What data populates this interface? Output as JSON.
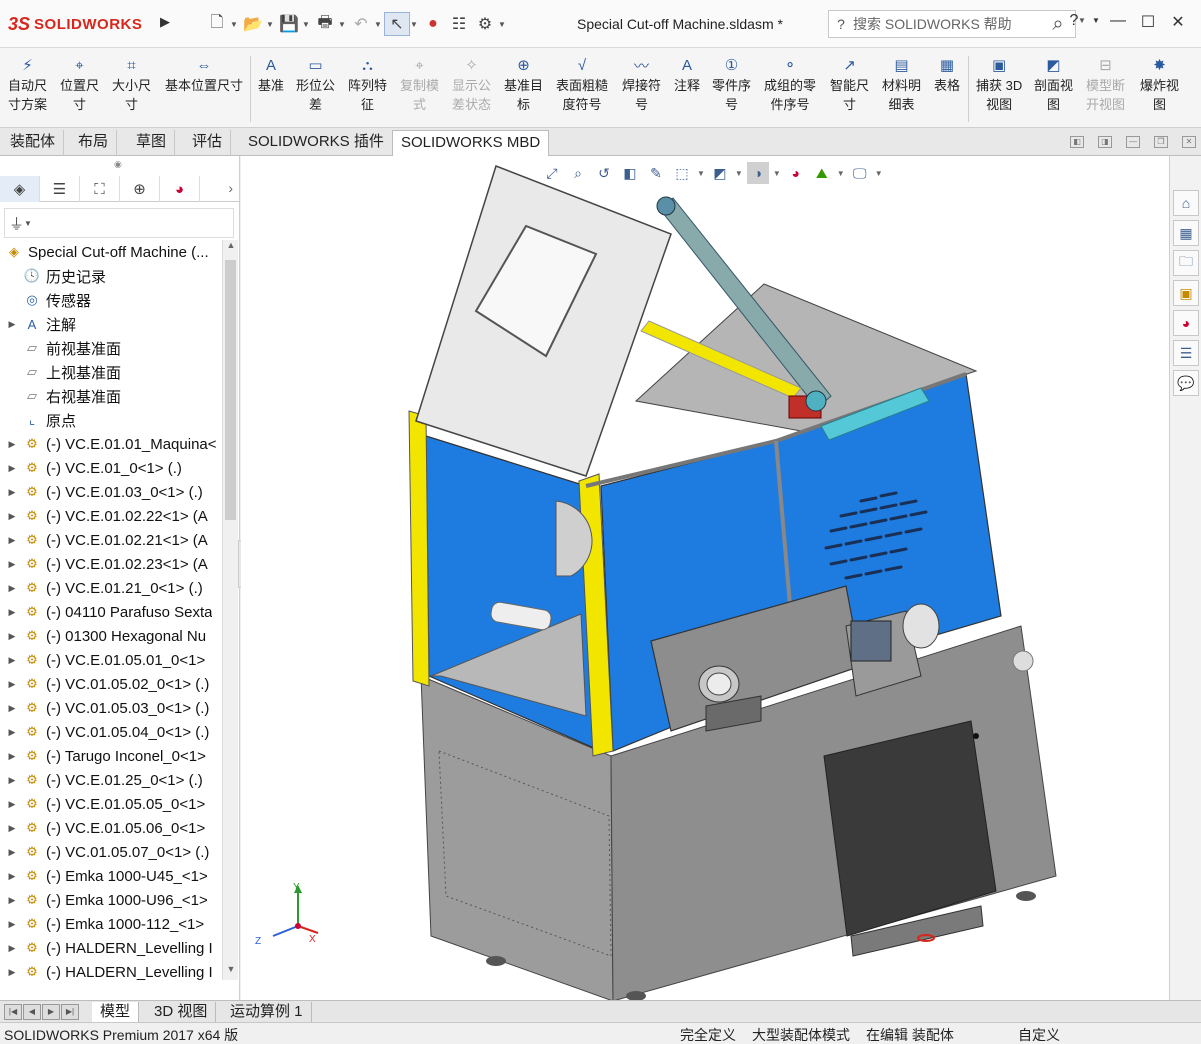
{
  "title_bar": {
    "brand_ds": "3S",
    "brand_name": "SOLIDWORKS",
    "document_title": "Special Cut-off Machine.sldasm *",
    "search_placeholder": "搜索 SOLIDWORKS 帮助",
    "help": "?"
  },
  "ribbon": {
    "buttons": [
      {
        "label": "自动尺\n寸方案",
        "icon": "auto-dimension-icon"
      },
      {
        "label": "位置尺\n寸",
        "icon": "location-dimension-icon"
      },
      {
        "label": "大小尺\n寸",
        "icon": "size-dimension-icon"
      },
      {
        "label": "基本位置尺寸",
        "icon": "basic-location-dimension-icon"
      },
      {
        "label": "基准",
        "icon": "datum-icon"
      },
      {
        "label": "形位公\n差",
        "icon": "geometric-tolerance-icon"
      },
      {
        "label": "阵列特\n征",
        "icon": "pattern-feature-icon"
      },
      {
        "label": "复制模\n式",
        "icon": "copy-scheme-icon",
        "disabled": true
      },
      {
        "label": "显示公\n差状态",
        "icon": "show-tolerance-status-icon",
        "disabled": true
      },
      {
        "label": "基准目\n标",
        "icon": "datum-target-icon"
      },
      {
        "label": "表面粗糙\n度符号",
        "icon": "surface-finish-icon"
      },
      {
        "label": "焊接符\n号",
        "icon": "weld-symbol-icon"
      },
      {
        "label": "注释",
        "icon": "note-icon"
      },
      {
        "label": "零件序\n号",
        "icon": "balloon-icon"
      },
      {
        "label": "成组的零\n件序号",
        "icon": "stacked-balloon-icon"
      },
      {
        "label": "智能尺\n寸",
        "icon": "smart-dimension-icon"
      },
      {
        "label": "材料明\n细表",
        "icon": "bom-icon"
      },
      {
        "label": "表格",
        "icon": "table-icon"
      },
      {
        "label": "捕获 3D\n视图",
        "icon": "capture-3d-view-icon"
      },
      {
        "label": "剖面视\n图",
        "icon": "section-view-icon"
      },
      {
        "label": "模型断\n开视图",
        "icon": "model-break-view-icon",
        "disabled": true
      },
      {
        "label": "爆炸视\n图",
        "icon": "exploded-view-icon"
      }
    ]
  },
  "tabs": [
    "装配体",
    "布局",
    "草图",
    "评估",
    "SOLIDWORKS 插件",
    "SOLIDWORKS MBD"
  ],
  "active_tab": "SOLIDWORKS MBD",
  "feature_tree": {
    "root": "Special Cut-off Machine  (...",
    "items": [
      {
        "label": "历史记录",
        "icon": "history-icon",
        "expand": false
      },
      {
        "label": "传感器",
        "icon": "sensor-icon",
        "expand": false
      },
      {
        "label": "注解",
        "icon": "annotations-icon",
        "expand": true
      },
      {
        "label": "前视基准面",
        "icon": "plane-icon",
        "expand": false
      },
      {
        "label": "上视基准面",
        "icon": "plane-icon",
        "expand": false
      },
      {
        "label": "右视基准面",
        "icon": "plane-icon",
        "expand": false
      },
      {
        "label": "原点",
        "icon": "origin-icon",
        "expand": false
      },
      {
        "label": "(-) VC.E.01.01_Maquina<",
        "icon": "component-icon",
        "expand": true
      },
      {
        "label": "(-) VC.E.01_0<1> (.)",
        "icon": "component-icon",
        "expand": true
      },
      {
        "label": "(-) VC.E.01.03_0<1> (.)",
        "icon": "component-icon",
        "expand": true
      },
      {
        "label": "(-) VC.E.01.02.22<1> (A",
        "icon": "component-icon",
        "expand": true
      },
      {
        "label": "(-) VC.E.01.02.21<1> (A",
        "icon": "component-icon",
        "expand": true
      },
      {
        "label": "(-) VC.E.01.02.23<1> (A",
        "icon": "component-icon",
        "expand": true
      },
      {
        "label": "(-) VC.E.01.21_0<1> (.)",
        "icon": "component-icon",
        "expand": true
      },
      {
        "label": "(-) 04110 Parafuso Sexta",
        "icon": "component-icon",
        "expand": true
      },
      {
        "label": "(-) 01300 Hexagonal Nu",
        "icon": "component-icon",
        "expand": true
      },
      {
        "label": "(-) VC.E.01.05.01_0<1>",
        "icon": "component-icon",
        "expand": true
      },
      {
        "label": "(-) VC.01.05.02_0<1> (.)",
        "icon": "component-icon",
        "expand": true
      },
      {
        "label": "(-) VC.01.05.03_0<1> (.)",
        "icon": "component-icon",
        "expand": true
      },
      {
        "label": "(-) VC.01.05.04_0<1> (.)",
        "icon": "component-icon",
        "expand": true
      },
      {
        "label": "(-) Tarugo Inconel_0<1>",
        "icon": "component-icon",
        "expand": true
      },
      {
        "label": "(-) VC.E.01.25_0<1> (.)",
        "icon": "component-icon",
        "expand": true
      },
      {
        "label": "(-) VC.E.01.05.05_0<1>",
        "icon": "component-icon",
        "expand": true
      },
      {
        "label": "(-) VC.E.01.05.06_0<1>",
        "icon": "component-icon",
        "expand": true
      },
      {
        "label": "(-) VC.01.05.07_0<1> (.)",
        "icon": "component-icon",
        "expand": true
      },
      {
        "label": "(-) Emka 1000-U45_<1>",
        "icon": "component-icon",
        "expand": true
      },
      {
        "label": "(-) Emka 1000-U96_<1>",
        "icon": "component-icon",
        "expand": true
      },
      {
        "label": "(-) Emka 1000-112_<1>",
        "icon": "component-icon",
        "expand": true
      },
      {
        "label": "(-) HALDERN_Levelling I",
        "icon": "component-icon",
        "expand": true
      },
      {
        "label": "(-) HALDERN_Levelling I",
        "icon": "component-icon",
        "expand": true
      }
    ]
  },
  "triad": {
    "y": "Y",
    "z": "Z",
    "x": "X"
  },
  "bottom_tabs": [
    "模型",
    "3D 视图",
    "运动算例 1"
  ],
  "active_bottom_tab": "模型",
  "status_bar": {
    "product": "SOLIDWORKS Premium 2017 x64 版",
    "definition": "完全定义",
    "mode": "大型装配体模式",
    "editing": "在编辑 装配体",
    "units": "自定义"
  },
  "colors": {
    "brand_red": "#d9261c",
    "panel_blue": "#1e7ce0",
    "frame_yellow": "#f2e600",
    "body_gray": "#9a9a9a"
  }
}
